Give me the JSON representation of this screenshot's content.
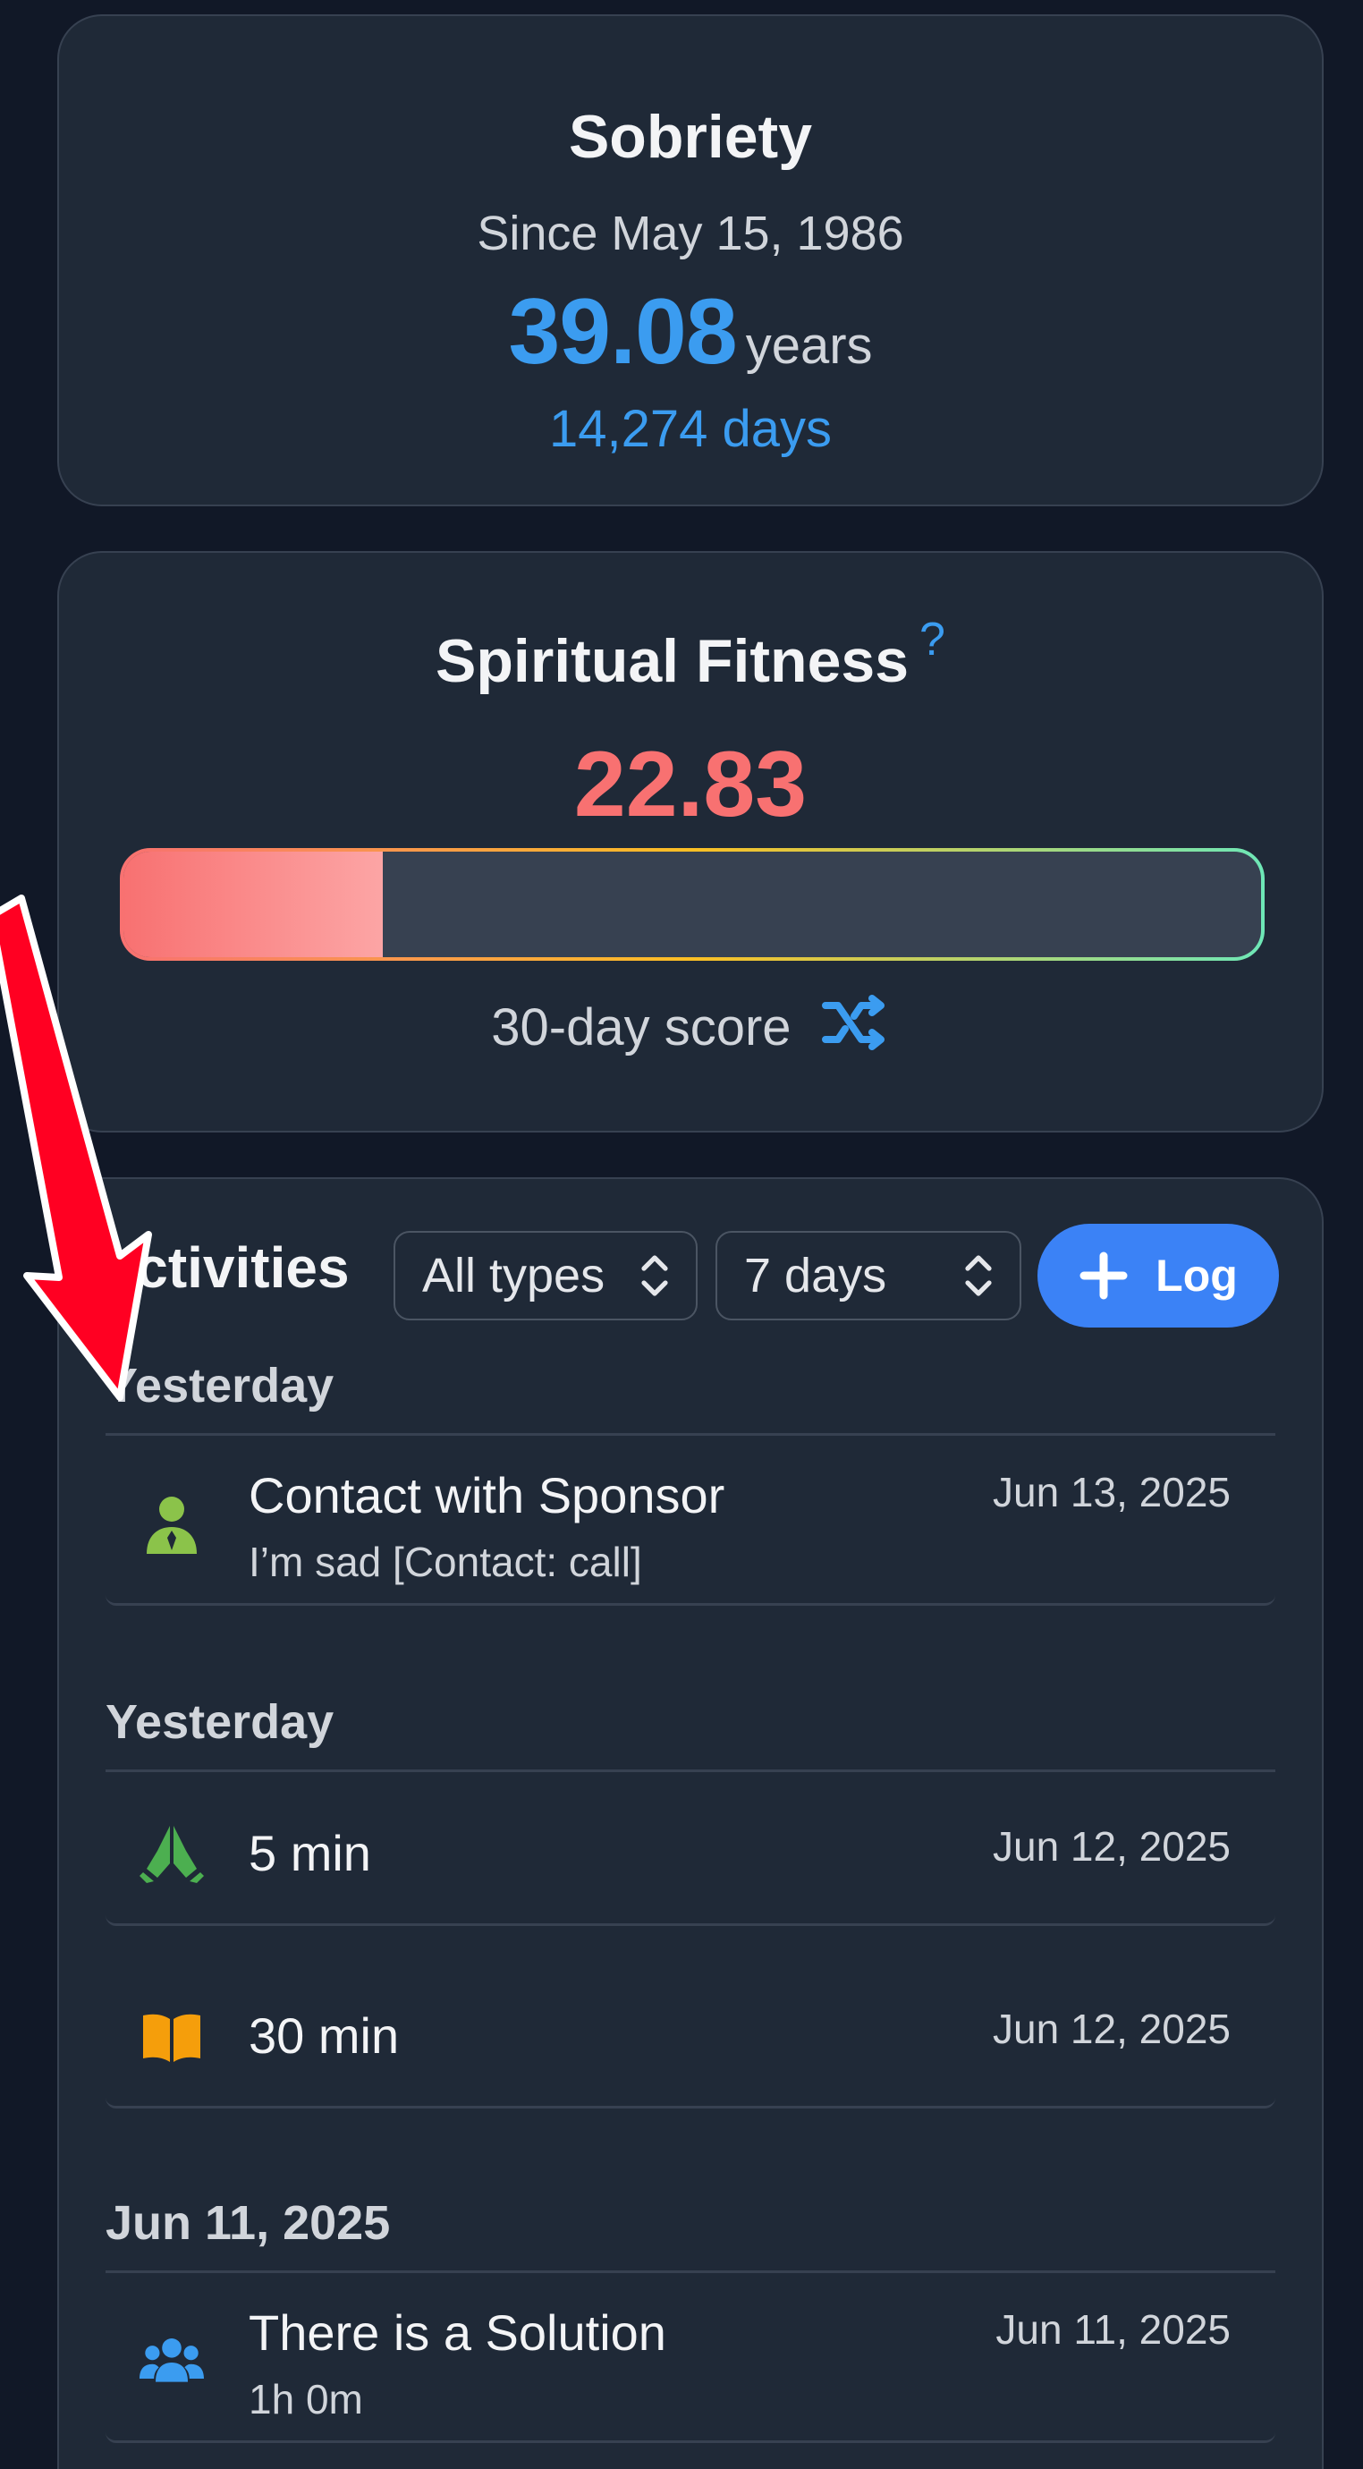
{
  "sobriety": {
    "title": "Sobriety",
    "since": "Since May 15, 1986",
    "years_value": "39.08",
    "years_unit": "years",
    "days": "14,274 days"
  },
  "fitness": {
    "title": "Spiritual Fitness",
    "help": "?",
    "score": "22.83",
    "progress_percent": 22.83,
    "caption": "30-day score",
    "caption_icon": "shuffle-icon"
  },
  "activities": {
    "title": "Activities",
    "filter_type": "All types",
    "filter_range": "7 days",
    "log_label": "Log",
    "groups": [
      {
        "label": "Yesterday",
        "items": [
          {
            "icon": "sponsor-icon",
            "title": "Contact with Sponsor",
            "subtitle": "I’m sad [Contact: call]",
            "date": "Jun 13, 2025",
            "color": "#8bc34a"
          }
        ]
      },
      {
        "label": "Yesterday",
        "items": [
          {
            "icon": "praying-hands-icon",
            "title": "5 min",
            "date": "Jun 12, 2025",
            "color": "#4caf50"
          },
          {
            "icon": "book-icon",
            "title": "30 min",
            "date": "Jun 12, 2025",
            "color": "#f59e0b"
          }
        ]
      },
      {
        "label": "Jun 11, 2025",
        "items": [
          {
            "icon": "group-meeting-icon",
            "title": "There is a Solution",
            "subtitle": "1h 0m",
            "date": "Jun 11, 2025",
            "color": "#3b9cf0"
          }
        ]
      }
    ]
  },
  "colors": {
    "background": "#111827",
    "card": "#1f2937",
    "accent_blue": "#3b9cf0",
    "score_red": "#f87171",
    "log_button": "#3b82f6",
    "annotation_arrow": "#ff0022"
  }
}
